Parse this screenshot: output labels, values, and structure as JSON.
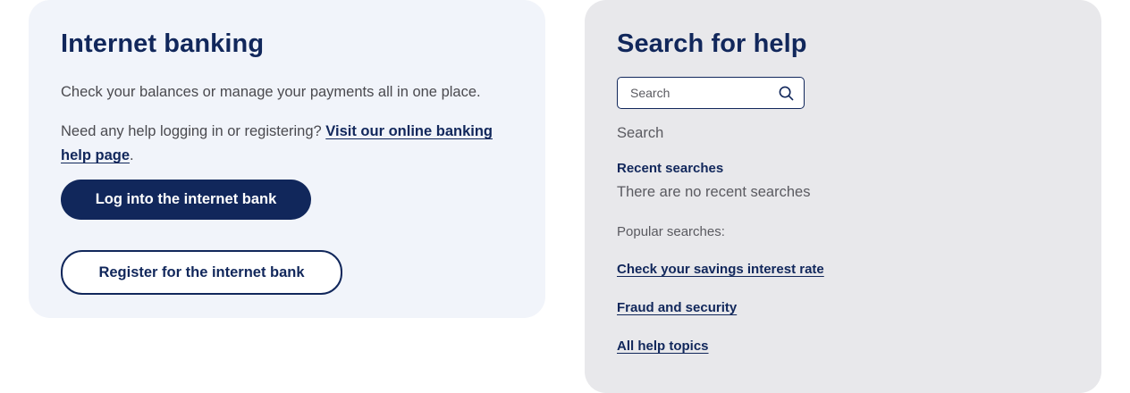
{
  "banking": {
    "title": "Internet banking",
    "intro": "Check your balances or manage your payments all in one place.",
    "help_text": "Need any help logging in or registering? ",
    "help_link": "Visit our online banking help page",
    "help_suffix": ".",
    "login_button": "Log into the internet bank",
    "register_button": "Register for the internet bank"
  },
  "search": {
    "title": "Search for help",
    "placeholder": "Search",
    "icon": "search-icon",
    "label": "Search",
    "recent_title": "Recent searches",
    "recent_empty": "There are no recent searches",
    "popular_title": "Popular searches:",
    "popular": [
      {
        "label": "Check your savings interest rate"
      },
      {
        "label": "Fraud and security"
      },
      {
        "label": "All help topics"
      }
    ]
  },
  "colors": {
    "brand_navy": "#11275b",
    "banking_card_bg": "#f1f4fa",
    "search_card_bg": "#e8e8eb"
  }
}
